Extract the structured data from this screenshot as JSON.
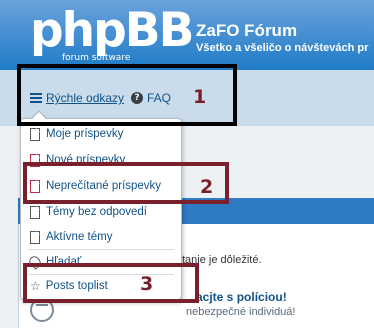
{
  "header": {
    "logo_text": "phpBB",
    "logo_sub": "forum  software",
    "site_title": "ZaFO Fórum",
    "site_description": "Všetko a všeličo o návštevách pr"
  },
  "nav": {
    "quicklinks_label": "Rýchle odkazy",
    "quicklinks_icon": "hamburger-icon",
    "faq_label": "FAQ",
    "faq_icon": "question-circle-icon"
  },
  "dropdown": {
    "items": [
      {
        "label": "Moje príspevky",
        "icon": "file-icon"
      },
      {
        "label": "Nové príspevky",
        "icon": "file-red-icon"
      },
      {
        "label": "Neprečítané príspevky",
        "icon": "file-red-icon"
      },
      {
        "label": "Témy bez odpovedí",
        "icon": "file-icon"
      },
      {
        "label": "Aktívne témy",
        "icon": "file-icon"
      },
      {
        "label": "Hľadať",
        "icon": "map-marker-icon"
      },
      {
        "label": "Posts toplist",
        "icon": "star-icon"
      }
    ]
  },
  "background": {
    "text_1": "tanie je dôležité.",
    "heading": "acjte s políciou!",
    "text_2": "nebezpečné individuá!"
  },
  "annotations": {
    "n1": "1",
    "n2": "2",
    "n3": "3",
    "color_black": "#000000",
    "color_red": "#7a1f2c"
  }
}
